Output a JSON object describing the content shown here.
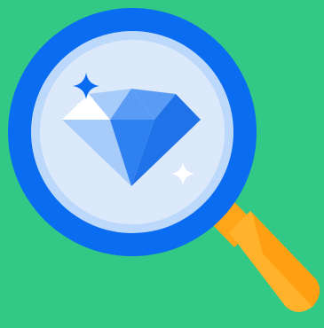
{
  "illustration": {
    "subject": "magnifying-glass-over-diamond",
    "icons": [
      "magnifying-glass-icon",
      "diamond-icon",
      "sparkle-icon",
      "sparkle-icon"
    ]
  },
  "colors": {
    "background": "#32c886",
    "lens_ring": "#0a6cf0",
    "lens_inner_ring": "#bcd8fb",
    "lens_glass": "#dce9fb",
    "handle_light": "#ffb22a",
    "handle_dark": "#ff9f12",
    "handle_collar": "#ffa51a",
    "sparkle": "#ffffff",
    "sparkle_blue": "#0a6cf0",
    "diamond_light": "#a8ccfa",
    "diamond_mid": "#5a9cf5",
    "diamond_dark": "#1f72e8",
    "diamond_white": "#ffffff"
  }
}
